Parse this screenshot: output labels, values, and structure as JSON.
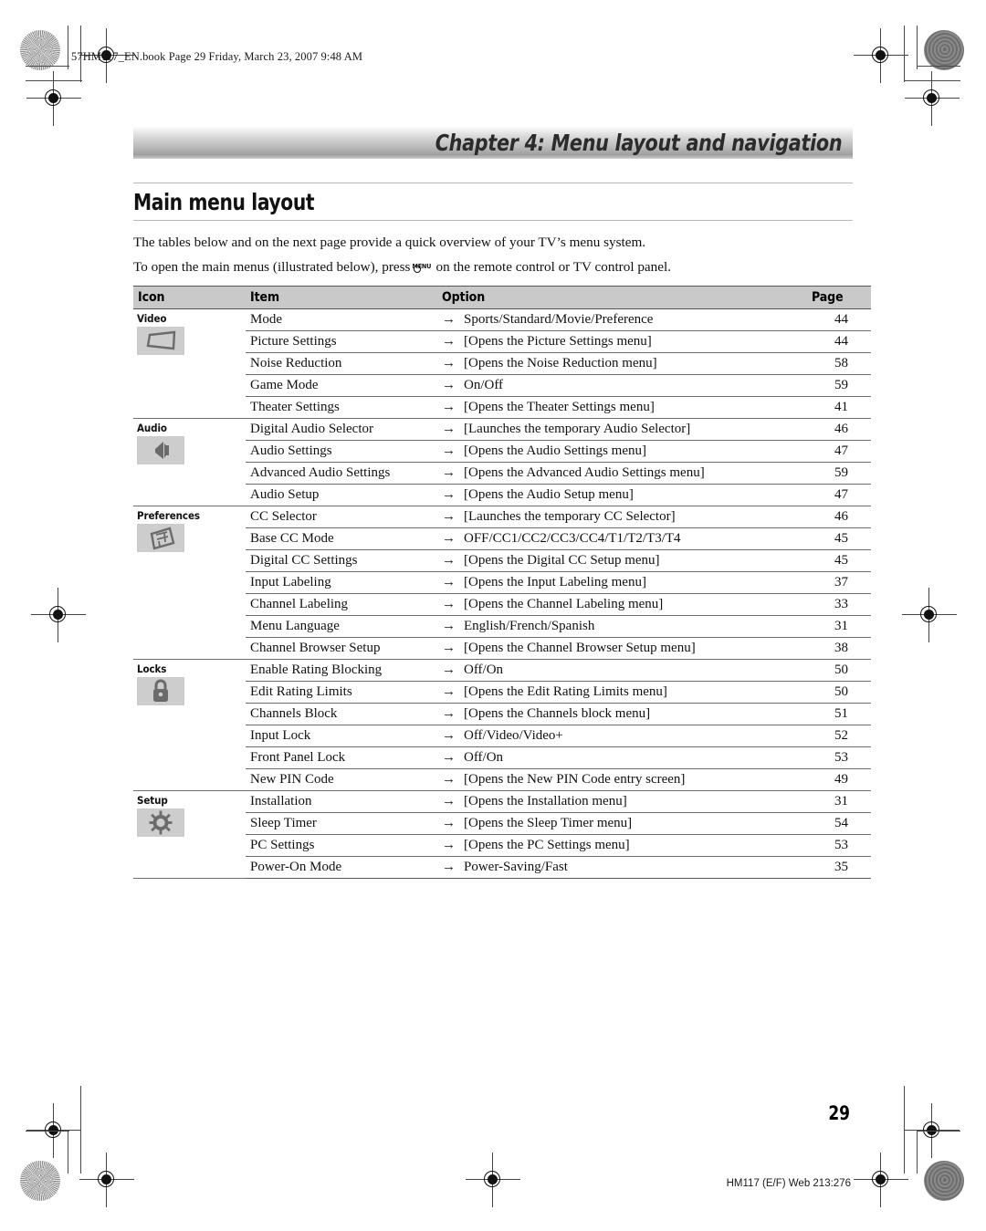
{
  "print_header": "57HM117_EN.book  Page 29  Friday, March 23, 2007  9:48 AM",
  "chapter": {
    "title": "Chapter 4: Menu layout and navigation"
  },
  "section": {
    "title": "Main menu layout"
  },
  "intro": {
    "line1": "The tables below and on the next page provide a quick overview of your TV’s menu system.",
    "line2_before": "To open the main menus (illustrated below), press",
    "menu_glyph_label": "MENU",
    "line2_after": "on the remote control or TV control panel."
  },
  "table": {
    "headers": {
      "icon": "Icon",
      "item": "Item",
      "option": "Option",
      "page": "Page"
    },
    "arrow": "→",
    "groups": [
      {
        "label": "Video",
        "icon": "video-screen-icon",
        "rows": [
          {
            "item": "Mode",
            "option": "Sports/Standard/Movie/Preference",
            "page": "44"
          },
          {
            "item": "Picture Settings",
            "option": "[Opens the Picture Settings menu]",
            "page": "44"
          },
          {
            "item": "Noise Reduction",
            "option": "[Opens the Noise Reduction menu]",
            "page": "58"
          },
          {
            "item": "Game Mode",
            "option": "On/Off",
            "page": "59"
          },
          {
            "item": "Theater Settings",
            "option": "[Opens the Theater Settings menu]",
            "page": "41"
          }
        ]
      },
      {
        "label": "Audio",
        "icon": "speaker-icon",
        "rows": [
          {
            "item": "Digital Audio Selector",
            "option": "[Launches the temporary Audio Selector]",
            "page": "46"
          },
          {
            "item": "Audio Settings",
            "option": "[Opens the Audio Settings menu]",
            "page": "47"
          },
          {
            "item": "Advanced Audio Settings",
            "option": "[Opens the Advanced Audio Settings menu]",
            "page": "59"
          },
          {
            "item": "Audio Setup",
            "option": "[Opens the Audio Setup menu]",
            "page": "47"
          }
        ]
      },
      {
        "label": "Preferences",
        "icon": "sliders-panel-icon",
        "rows": [
          {
            "item": "CC Selector",
            "option": "[Launches the temporary CC Selector]",
            "page": "46"
          },
          {
            "item": "Base CC Mode",
            "option": "OFF/CC1/CC2/CC3/CC4/T1/T2/T3/T4",
            "page": "45"
          },
          {
            "item": "Digital CC Settings",
            "option": "[Opens the Digital CC Setup menu]",
            "page": "45"
          },
          {
            "item": "Input Labeling",
            "option": "[Opens the Input Labeling menu]",
            "page": "37"
          },
          {
            "item": "Channel Labeling",
            "option": "[Opens the Channel Labeling menu]",
            "page": "33"
          },
          {
            "item": "Menu Language",
            "option": "English/French/Spanish",
            "page": "31"
          },
          {
            "item": "Channel Browser Setup",
            "option": "[Opens the Channel Browser Setup menu]",
            "page": "38"
          }
        ]
      },
      {
        "label": "Locks",
        "icon": "padlock-icon",
        "rows": [
          {
            "item": "Enable Rating Blocking",
            "option": "Off/On",
            "page": "50"
          },
          {
            "item": "Edit Rating Limits",
            "option": "[Opens the Edit Rating Limits menu]",
            "page": "50"
          },
          {
            "item": "Channels Block",
            "option": "[Opens the Channels block menu]",
            "page": "51"
          },
          {
            "item": "Input Lock",
            "option": "Off/Video/Video+",
            "page": "52"
          },
          {
            "item": "Front Panel Lock",
            "option": "Off/On",
            "page": "53"
          },
          {
            "item": "New PIN Code",
            "option": "[Opens the New PIN Code entry screen]",
            "page": "49"
          }
        ]
      },
      {
        "label": "Setup",
        "icon": "gear-icon",
        "rows": [
          {
            "item": "Installation",
            "option": "[Opens the Installation menu]",
            "page": "31"
          },
          {
            "item": "Sleep Timer",
            "option": "[Opens the Sleep Timer menu]",
            "page": "54"
          },
          {
            "item": "PC Settings",
            "option": "[Opens the PC Settings menu]",
            "page": "53"
          },
          {
            "item": "Power-On Mode",
            "option": "Power-Saving/Fast",
            "page": "35"
          }
        ]
      }
    ]
  },
  "page_number": "29",
  "footer": "HM117 (E/F) Web 213:276"
}
